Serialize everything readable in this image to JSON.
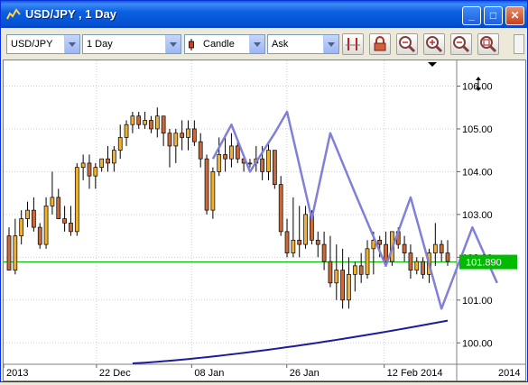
{
  "window": {
    "title": "USD/JPY , 1 Day",
    "minimize_glyph": "_",
    "maximize_glyph": "□",
    "close_glyph": "✕"
  },
  "toolbar": {
    "symbol": "USD/JPY",
    "timeframe": "1 Day",
    "chart_type": "Candle",
    "price_side": "Ask",
    "buttons": [
      "period-separator-icon",
      "lock-icon",
      "zoom-fit-icon",
      "zoom-in-icon",
      "zoom-out-icon",
      "zoom-reset-icon"
    ]
  },
  "chart_data": {
    "type": "candlestick",
    "y_ticks": [
      "106.00",
      "105.00",
      "104.00",
      "103.00",
      "102.00",
      "101.00",
      "100.00"
    ],
    "x_ticks": [
      "2013",
      "22 Dec",
      "08 Jan",
      "26 Jan",
      "12 Feb 2014",
      "2014"
    ],
    "current_price_label": "101.890",
    "current_price": 101.89,
    "ylim": [
      99.5,
      106.6
    ],
    "colors": {
      "bull": "#f0b030",
      "bear": "#c86a3c",
      "zigzag": "#8080d8",
      "ma": "#1c1c9c",
      "price_line": "#00bb00"
    },
    "candles": [
      [
        102.5,
        102.7,
        101.7,
        101.7
      ],
      [
        101.7,
        102.9,
        101.6,
        102.5
      ],
      [
        102.5,
        103.1,
        102.3,
        102.9
      ],
      [
        102.9,
        103.3,
        102.7,
        103.1
      ],
      [
        103.1,
        103.4,
        102.6,
        102.7
      ],
      [
        102.7,
        102.8,
        102.2,
        102.3
      ],
      [
        102.3,
        103.4,
        102.2,
        103.2
      ],
      [
        103.2,
        104.0,
        103.0,
        103.4
      ],
      [
        103.4,
        103.6,
        102.9,
        102.9
      ],
      [
        102.9,
        103.2,
        102.6,
        102.8
      ],
      [
        102.8,
        103.2,
        102.5,
        102.6
      ],
      [
        102.6,
        104.2,
        102.5,
        104.1
      ],
      [
        104.1,
        104.4,
        103.8,
        104.2
      ],
      [
        104.2,
        104.4,
        103.6,
        103.9
      ],
      [
        103.9,
        104.2,
        103.6,
        104.1
      ],
      [
        104.1,
        104.3,
        104.0,
        104.3
      ],
      [
        104.3,
        104.6,
        104.0,
        104.2
      ],
      [
        104.2,
        104.6,
        104.0,
        104.5
      ],
      [
        104.5,
        105.1,
        104.3,
        104.8
      ],
      [
        104.8,
        105.2,
        104.6,
        105.1
      ],
      [
        105.1,
        105.4,
        104.9,
        105.3
      ],
      [
        105.3,
        105.4,
        105.0,
        105.1
      ],
      [
        105.1,
        105.4,
        105.0,
        105.2
      ],
      [
        105.2,
        105.3,
        104.9,
        105.0
      ],
      [
        105.0,
        105.5,
        104.8,
        105.3
      ],
      [
        105.3,
        105.3,
        104.6,
        104.9
      ],
      [
        104.9,
        105.0,
        104.1,
        104.6
      ],
      [
        104.6,
        105.0,
        104.2,
        104.9
      ],
      [
        104.9,
        105.2,
        104.5,
        104.8
      ],
      [
        104.8,
        105.2,
        104.5,
        105.0
      ],
      [
        105.0,
        105.2,
        104.6,
        104.7
      ],
      [
        104.7,
        104.9,
        104.1,
        104.3
      ],
      [
        104.3,
        104.4,
        103.0,
        103.1
      ],
      [
        103.1,
        104.1,
        102.9,
        104.0
      ],
      [
        104.0,
        104.8,
        103.9,
        104.4
      ],
      [
        104.4,
        104.8,
        104.0,
        104.3
      ],
      [
        104.3,
        104.9,
        104.1,
        104.6
      ],
      [
        104.6,
        104.7,
        104.2,
        104.3
      ],
      [
        104.3,
        104.4,
        104.0,
        104.2
      ],
      [
        104.2,
        104.3,
        104.1,
        104.2
      ],
      [
        104.2,
        104.6,
        104.0,
        104.3
      ],
      [
        104.3,
        104.6,
        103.8,
        104.0
      ],
      [
        104.0,
        104.7,
        103.8,
        104.5
      ],
      [
        104.5,
        104.5,
        103.6,
        103.7
      ],
      [
        103.7,
        103.9,
        102.5,
        102.6
      ],
      [
        102.6,
        102.9,
        102.0,
        102.1
      ],
      [
        102.1,
        103.4,
        102.0,
        102.4
      ],
      [
        102.4,
        103.2,
        102.0,
        102.3
      ],
      [
        102.3,
        103.2,
        102.2,
        103.0
      ],
      [
        103.0,
        103.1,
        102.3,
        102.4
      ],
      [
        102.4,
        102.6,
        102.0,
        102.3
      ],
      [
        102.3,
        102.6,
        101.7,
        101.9
      ],
      [
        101.9,
        102.5,
        101.3,
        101.4
      ],
      [
        101.4,
        102.3,
        101.0,
        101.7
      ],
      [
        101.7,
        102.2,
        100.8,
        101.0
      ],
      [
        101.0,
        102.0,
        100.8,
        101.6
      ],
      [
        101.6,
        101.9,
        101.2,
        101.8
      ],
      [
        101.8,
        102.1,
        101.4,
        101.6
      ],
      [
        101.6,
        102.4,
        101.5,
        102.2
      ],
      [
        102.2,
        102.6,
        101.6,
        102.4
      ],
      [
        102.4,
        102.5,
        102.0,
        102.3
      ],
      [
        102.3,
        102.6,
        101.8,
        101.9
      ],
      [
        101.9,
        102.6,
        101.8,
        102.6
      ],
      [
        102.6,
        102.7,
        102.2,
        102.3
      ],
      [
        102.3,
        102.5,
        101.9,
        102.1
      ],
      [
        102.1,
        102.3,
        101.5,
        101.7
      ],
      [
        101.7,
        102.0,
        101.6,
        101.9
      ],
      [
        101.9,
        102.0,
        101.5,
        101.6
      ],
      [
        101.6,
        102.2,
        101.4,
        102.1
      ],
      [
        102.1,
        102.8,
        101.8,
        102.3
      ],
      [
        102.3,
        102.4,
        101.9,
        102.1
      ],
      [
        102.1,
        102.4,
        101.8,
        101.9
      ]
    ],
    "zigzag": [
      [
        33,
        104.3
      ],
      [
        36,
        105.1
      ],
      [
        39,
        104.0
      ],
      [
        43,
        104.9
      ],
      [
        45,
        105.4
      ],
      [
        49,
        102.9
      ],
      [
        52,
        104.9
      ],
      [
        56,
        103.5
      ],
      [
        61,
        101.8
      ],
      [
        65,
        103.4
      ],
      [
        70,
        100.8
      ],
      [
        75,
        102.7
      ],
      [
        79,
        101.4
      ]
    ],
    "zigzag_x0_index": 33
  }
}
